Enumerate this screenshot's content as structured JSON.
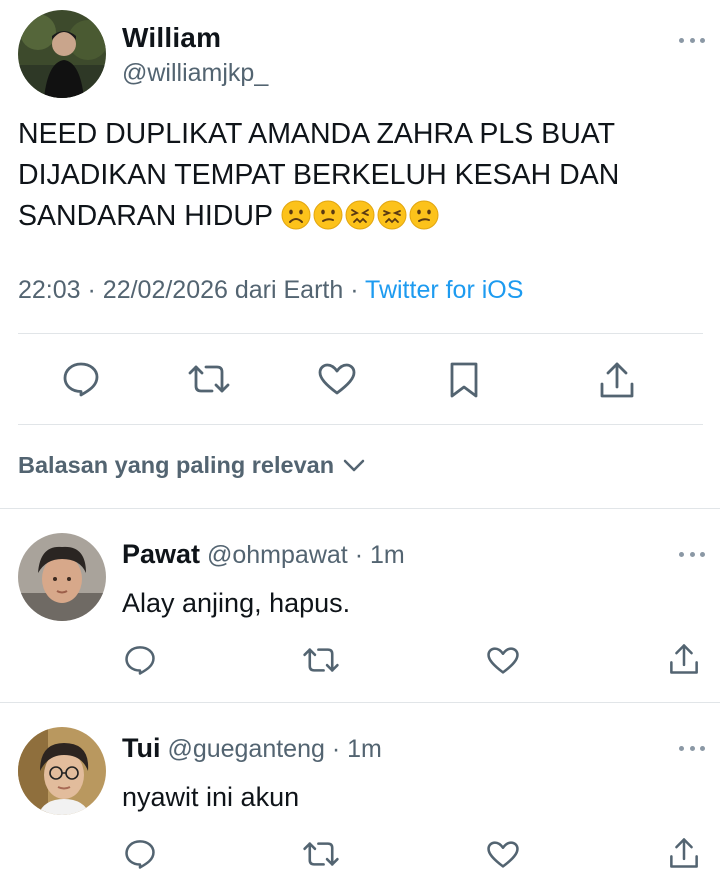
{
  "tweet": {
    "author_name": "William",
    "author_handle": "@williamjkp_",
    "text": "NEED DUPLIKAT AMANDA ZAHRA PLS BUAT DIJADIKAN TEMPAT BERKELUH KESAH DAN SANDARAN HIDUP",
    "emojis": [
      "frowning-face",
      "confused-face",
      "confounded-face",
      "confounded-face",
      "confused-face"
    ],
    "time": "22:03",
    "date": "22/02/2026",
    "location_text": "dari Earth",
    "separator": "·",
    "source": "Twitter for iOS",
    "actions": [
      "reply-icon",
      "retweet-icon",
      "like-icon",
      "bookmark-icon",
      "share-icon"
    ]
  },
  "sort": {
    "label": "Balasan yang paling relevan",
    "icon": "chevron-down-icon"
  },
  "replies": [
    {
      "name": "Pawat",
      "handle": "@ohmpawat",
      "separator": "·",
      "time": "1m",
      "text": "Alay anjing, hapus."
    },
    {
      "name": "Tui",
      "handle": "@gueganteng",
      "separator": "·",
      "time": "1m",
      "text": "nyawit ini akun"
    }
  ],
  "colors": {
    "text": "#0f1419",
    "secondary": "#536471",
    "link": "#1d9bf0",
    "divider": "#e1e5e8",
    "emoji_face": "#fcc21b"
  }
}
